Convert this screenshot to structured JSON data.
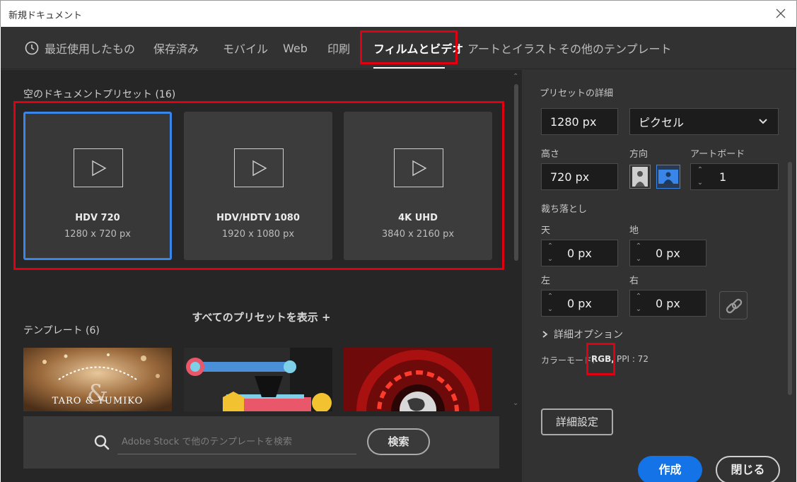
{
  "window": {
    "title": "新規ドキュメント"
  },
  "tabs": [
    {
      "label": "最近使用したもの"
    },
    {
      "label": "保存済み"
    },
    {
      "label": "モバイル"
    },
    {
      "label": "Web"
    },
    {
      "label": "印刷"
    },
    {
      "label": "フィルムとビデオ"
    },
    {
      "label": "アートとイラスト"
    },
    {
      "label": "その他のテンプレート"
    }
  ],
  "left": {
    "presets_title": "空のドキュメントプリセット (16)",
    "presets": [
      {
        "name": "HDV 720",
        "size": "1280 x 720 px"
      },
      {
        "name": "HDV/HDTV 1080",
        "size": "1920 x 1080 px"
      },
      {
        "name": "4K UHD",
        "size": "3840 x 2160 px"
      }
    ],
    "show_all": "すべてのプリセットを表示 +",
    "templates_title": "テンプレート (6)",
    "template1_text": "TARO   &   YUMIKO",
    "search": {
      "placeholder": "Adobe Stock で他のテンプレートを検索",
      "button": "検索"
    }
  },
  "right": {
    "details_title": "プリセットの詳細",
    "width": "1280 px",
    "unit": "ピクセル",
    "height_label": "高さ",
    "height": "720 px",
    "orientation_label": "方向",
    "artboard_label": "アートボード",
    "artboard": "1",
    "bleed_label": "裁ち落とし",
    "top_label": "天",
    "top": "0 px",
    "bottom_label": "地",
    "bottom": "0 px",
    "left_label": "左",
    "left": "0 px",
    "right_label": "右",
    "right": "0 px",
    "advanced_label": "詳細オプション",
    "color_mode_prefix": "カラーモード:",
    "color_mode": "RGB,",
    "ppi": "PPI : 72",
    "advanced_settings": "詳細設定",
    "create": "作成",
    "close": "閉じる"
  },
  "colors": {
    "accent": "#1473e6",
    "highlight": "#e00012",
    "selected": "#3a86e8"
  }
}
